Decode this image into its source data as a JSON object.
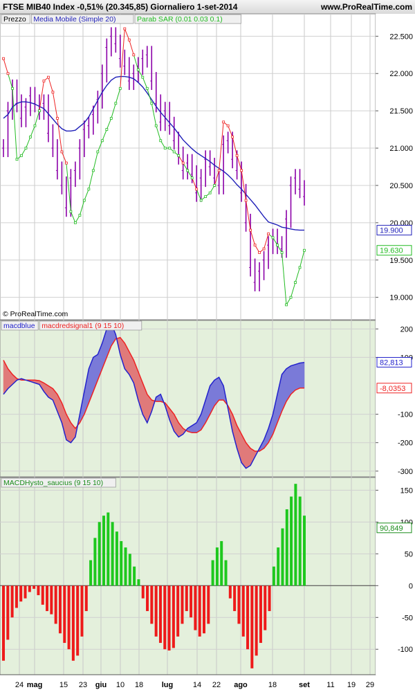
{
  "header": {
    "title": "FTSE MIB40 Index   -0,51% (20.345,85)   Giornaliero   1-set-2014",
    "site": "www.ProRealTime.com"
  },
  "colors": {
    "price": "#8b00a8",
    "ma": "#1f1fb8",
    "sar": "#ee2222",
    "sar_below": "#22bb22",
    "macd": "#2222cc",
    "signal": "#ee2222",
    "fill": "#e07a7a",
    "fill_neg": "#7a7ad8",
    "hist_pos": "#1ec81e",
    "hist_neg": "#ee1a1a",
    "panel_bg": "#e4f0dc"
  },
  "chart_data": [
    {
      "type": "line",
      "panel": "price",
      "title": "",
      "legend": [
        "Prezzo",
        "Media Mobile (Simple 20)",
        "Parab SAR (0.01 0.03 0.1)"
      ],
      "legend_placement": "top-left",
      "watermark": "© ProRealTime.com",
      "ylim": [
        18700,
        22800
      ],
      "yticks": [
        19000,
        19500,
        20000,
        20500,
        21000,
        21500,
        22000,
        22500
      ],
      "ytick_labels": [
        "19.000",
        "19.500",
        "20.000",
        "20.500",
        "21.000",
        "21.500",
        "22.000",
        "22.500"
      ],
      "last_values": {
        "ma": "19.900",
        "sar": "19.630"
      },
      "x": [
        "24",
        "mag",
        "15",
        "23",
        "giu",
        "10",
        "18",
        "lug",
        "14",
        "22",
        "ago",
        "18",
        "set",
        "11",
        "19",
        "29"
      ],
      "series": [
        {
          "name": "Prezzo",
          "values": [
            21000,
            21500,
            21800,
            21600,
            21400,
            21550,
            21700,
            21600,
            21500,
            21600,
            21200,
            21000,
            20700,
            20500,
            20200,
            20600,
            20700,
            21000,
            21250,
            21300,
            21450,
            21650,
            22000,
            22350,
            22500,
            22400,
            22200,
            22100,
            21900,
            22000,
            22100,
            22200,
            22250,
            21900,
            21600,
            21350,
            21500,
            21300,
            21100,
            20900,
            20700,
            20800,
            20650,
            20400,
            20600,
            20850,
            20750,
            20600,
            20500,
            21050,
            21100,
            20850,
            20700,
            20400,
            20000,
            19400,
            19200,
            19350,
            19500,
            19700,
            19800,
            19700,
            19650,
            20050,
            20500,
            20600,
            20450,
            20350
          ]
        },
        {
          "name": "Media Mobile (Simple 20)",
          "values": [
            21400,
            21450,
            21550,
            21600,
            21620,
            21620,
            21610,
            21590,
            21560,
            21530,
            21460,
            21390,
            21320,
            21260,
            21230,
            21230,
            21240,
            21290,
            21340,
            21420,
            21530,
            21640,
            21750,
            21840,
            21910,
            21950,
            21960,
            21960,
            21950,
            21930,
            21880,
            21820,
            21740,
            21650,
            21560,
            21480,
            21410,
            21340,
            21270,
            21190,
            21110,
            21050,
            20990,
            20940,
            20900,
            20860,
            20820,
            20770,
            20730,
            20690,
            20640,
            20580,
            20510,
            20450,
            20380,
            20310,
            20240,
            20160,
            20080,
            20010,
            19990,
            19970,
            19940,
            19930,
            19915,
            19905,
            19900,
            19900
          ]
        },
        {
          "name": "Parab SAR (0.01 0.03 0.1)",
          "values": [
            22200,
            22000,
            21800,
            20850,
            20900,
            21000,
            21150,
            21300,
            21500,
            21900,
            21950,
            21750,
            21400,
            20950,
            20800,
            20150,
            20000,
            20100,
            20300,
            20450,
            20700,
            20950,
            21100,
            21250,
            21400,
            21600,
            21800,
            22600,
            22450,
            22250,
            22050,
            21950,
            21800,
            21600,
            21300,
            21100,
            21000,
            21000,
            20950,
            20900,
            20800,
            20700,
            20600,
            20450,
            20300,
            20350,
            20400,
            20500,
            20700,
            21350,
            21300,
            21150,
            20900,
            20700,
            20300,
            19900,
            19700,
            19600,
            19650,
            19850,
            19800,
            19700,
            19600,
            18900,
            19000,
            19200,
            19400,
            19630
          ]
        }
      ]
    },
    {
      "type": "line",
      "panel": "macd",
      "legend": [
        "macdblue",
        "macdredsignal1 (9 15 10)"
      ],
      "legend_placement": "top-left",
      "ylim": [
        -320,
        230
      ],
      "yticks": [
        -300,
        -200,
        -100,
        100,
        200
      ],
      "ytick_labels": [
        "-300",
        "-200",
        "-100",
        "100",
        "200"
      ],
      "last_values": {
        "macd": "82,813",
        "signal": "-8,0353"
      },
      "series": [
        {
          "name": "macdblue",
          "values": [
            -30,
            -10,
            5,
            20,
            25,
            20,
            15,
            10,
            5,
            -20,
            -40,
            -50,
            -90,
            -130,
            -190,
            -200,
            -180,
            -100,
            -20,
            60,
            100,
            110,
            150,
            200,
            220,
            180,
            110,
            60,
            40,
            10,
            -50,
            -100,
            -130,
            -90,
            -40,
            -30,
            -70,
            -120,
            -160,
            -180,
            -170,
            -150,
            -140,
            -130,
            -100,
            -50,
            0,
            20,
            30,
            0,
            -80,
            -160,
            -220,
            -270,
            -290,
            -280,
            -250,
            -220,
            -190,
            -150,
            -100,
            -30,
            40,
            60,
            70,
            75,
            80,
            82
          ]
        },
        {
          "name": "macdredsignal1 (9 15 10)",
          "values": [
            90,
            60,
            40,
            25,
            20,
            20,
            20,
            20,
            18,
            10,
            0,
            -10,
            -30,
            -60,
            -100,
            -130,
            -150,
            -130,
            -100,
            -60,
            -20,
            20,
            60,
            100,
            140,
            165,
            170,
            150,
            120,
            90,
            50,
            10,
            -30,
            -50,
            -55,
            -55,
            -60,
            -80,
            -100,
            -130,
            -150,
            -160,
            -165,
            -165,
            -155,
            -130,
            -100,
            -70,
            -50,
            -50,
            -70,
            -100,
            -140,
            -170,
            -200,
            -220,
            -230,
            -230,
            -220,
            -200,
            -170,
            -130,
            -90,
            -55,
            -30,
            -15,
            -8,
            -8
          ]
        }
      ]
    },
    {
      "type": "bar",
      "panel": "histogram",
      "legend": [
        "MACDHysto_saucius (9 15 10)"
      ],
      "legend_placement": "top-left",
      "ylim": [
        -140,
        170
      ],
      "yticks": [
        -100,
        -50,
        0,
        50,
        100,
        150
      ],
      "ytick_labels": [
        "-100",
        "-50",
        "0",
        "50",
        "100",
        "150"
      ],
      "last_values": {
        "hist": "90,849"
      },
      "values": [
        -118,
        -85,
        -50,
        -35,
        -25,
        -20,
        -10,
        -5,
        -15,
        -30,
        -40,
        -45,
        -60,
        -75,
        -90,
        -100,
        -118,
        -110,
        -80,
        -40,
        40,
        75,
        100,
        110,
        115,
        100,
        85,
        70,
        60,
        50,
        30,
        10,
        -20,
        -40,
        -60,
        -80,
        -90,
        -100,
        -102,
        -98,
        -80,
        -60,
        -40,
        -50,
        -70,
        -80,
        -75,
        -60,
        40,
        60,
        70,
        40,
        -20,
        -40,
        -60,
        -80,
        -100,
        -130,
        -110,
        -90,
        -70,
        -40,
        30,
        60,
        90,
        120,
        140,
        160,
        140,
        110
      ]
    }
  ]
}
